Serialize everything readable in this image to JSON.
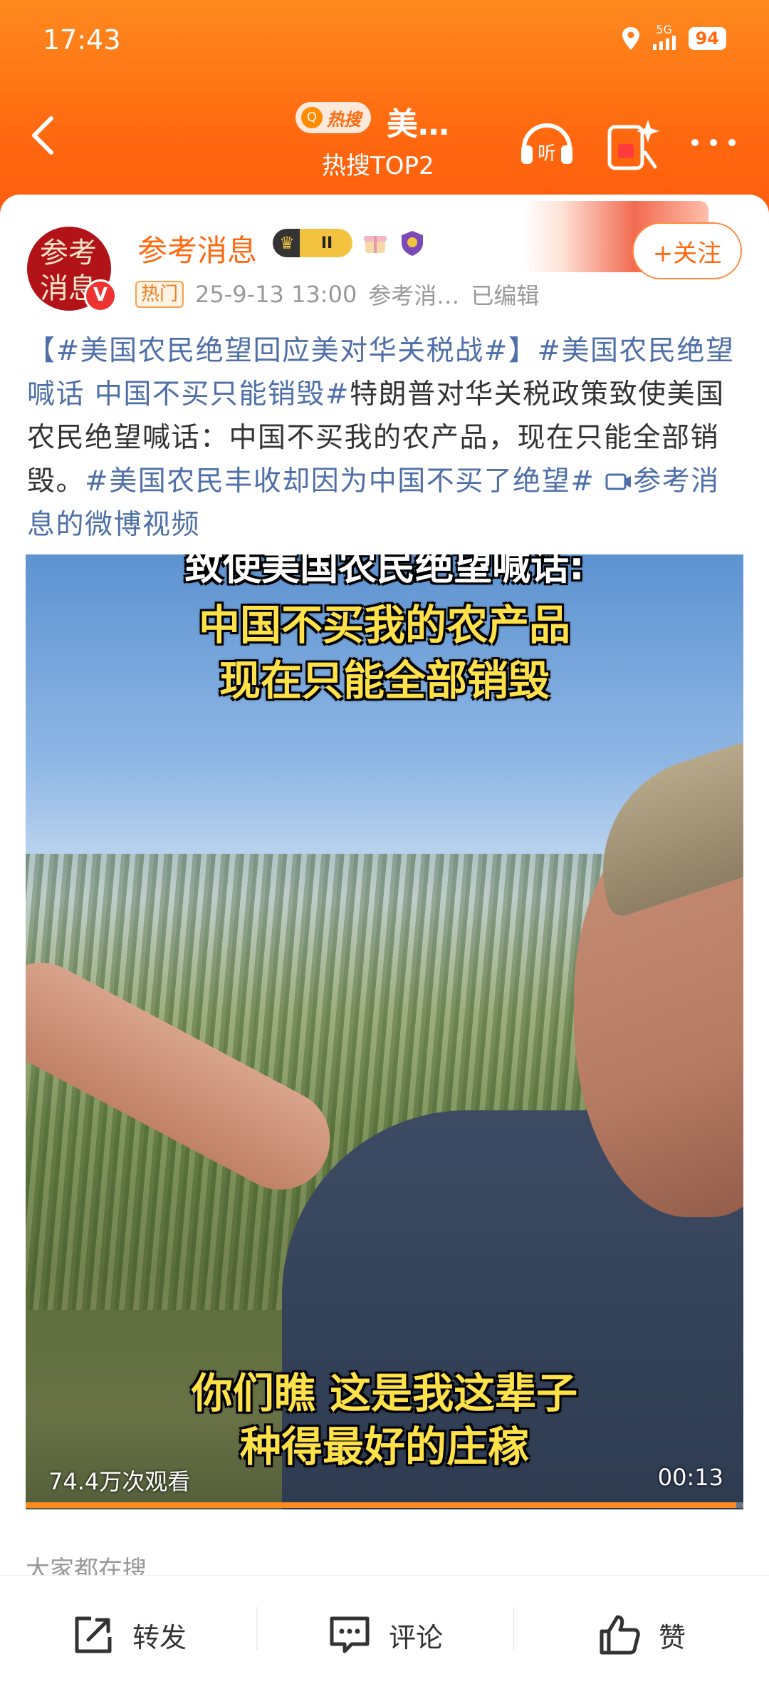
{
  "status_bar": {
    "time": "17:43",
    "network": "5G",
    "battery": "94"
  },
  "header": {
    "hot_label": "热搜",
    "title": "美…",
    "subtitle": "热搜TOP2"
  },
  "post": {
    "avatar_text": "参考消息",
    "username": "参考消息",
    "level": "II",
    "follow_label": "+关注",
    "hot_tag": "热门",
    "timestamp": "25-9-13 13:00",
    "source": "参考消…",
    "edited": "已编辑",
    "text_parts": {
      "t1": "【#美国农民绝望回应美对华关税战#】",
      "t2": "#美国农民绝望喊话 中国不买只能销毁#",
      "t3": "特朗普对华关税政策致使美国农民绝望喊话：中国不买我的农产品，现在只能全部销毁。",
      "t4": "#美国农民丰收却因为中国不买了绝望#",
      "t5": "参考消息的微博视频"
    }
  },
  "video": {
    "caption_top_1": "致使美国农民绝望喊话:",
    "caption_top_2": "中国不买我的农产品",
    "caption_top_3": "现在只能全部销毁",
    "caption_bottom_1": "你们瞧 这是我这辈子",
    "caption_bottom_2": "种得最好的庄稼",
    "views": "74.4万次观看",
    "duration": "00:13",
    "progress": 0.99
  },
  "search_section_label": "大家都在搜",
  "bottom_bar": {
    "repost": "转发",
    "comment": "评论",
    "like": "赞"
  },
  "colors": {
    "accent": "#ff6a10",
    "hashtag": "#4e6fa8"
  }
}
